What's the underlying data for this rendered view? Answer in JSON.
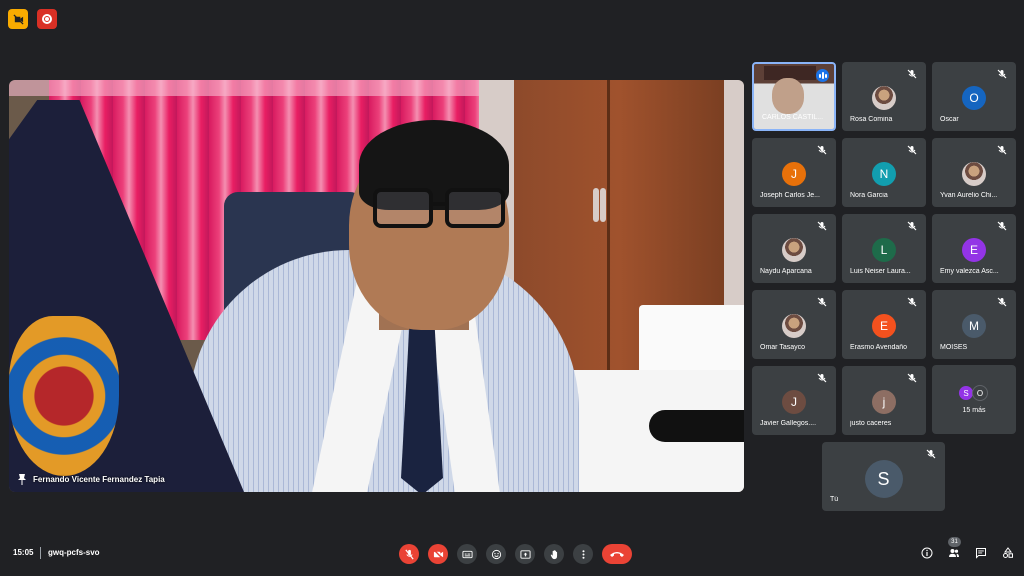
{
  "meeting": {
    "time": "15:05",
    "code": "gwq-pcfs-svo",
    "participant_count": "31"
  },
  "main_video": {
    "speaker_name": "Fernando Vicente Fernandez Tapia"
  },
  "tiles": [
    {
      "name": "CARLOS CASTIL...",
      "avatar": "",
      "color": "",
      "type": "active"
    },
    {
      "name": "Rosa Comina",
      "avatar": "",
      "color": "",
      "type": "photo"
    },
    {
      "name": "Oscar",
      "avatar": "O",
      "color": "#1565c0",
      "type": "letter"
    },
    {
      "name": "Joseph Carlos Je...",
      "avatar": "J",
      "color": "#e8710a",
      "type": "letter"
    },
    {
      "name": "Nora Garcia",
      "avatar": "N",
      "color": "#129eaf",
      "type": "letter"
    },
    {
      "name": "Yvan Aurelio Chi...",
      "avatar": "",
      "color": "",
      "type": "photo"
    },
    {
      "name": "Naydu Aparcana",
      "avatar": "",
      "color": "",
      "type": "photo"
    },
    {
      "name": "Luis Neiser Laura...",
      "avatar": "L",
      "color": "#1e6b4a",
      "type": "letter"
    },
    {
      "name": "Emy valezca Asc...",
      "avatar": "E",
      "color": "#9334e6",
      "type": "letter"
    },
    {
      "name": "Omar Tasayco",
      "avatar": "",
      "color": "",
      "type": "photo"
    },
    {
      "name": "Erasmo Avendaño",
      "avatar": "E",
      "color": "#f4511e",
      "type": "letter"
    },
    {
      "name": "MOISES",
      "avatar": "M",
      "color": "#4a5a6a",
      "type": "letter"
    },
    {
      "name": "Javier Gallegos....",
      "avatar": "J",
      "color": "#6d4c41",
      "type": "letter"
    },
    {
      "name": "justo caceres",
      "avatar": "j",
      "color": "#8d6e63",
      "type": "letter"
    }
  ],
  "more": {
    "label": "15 más",
    "a1": "S",
    "a2": "O"
  },
  "self": {
    "name": "Tú",
    "avatar": "S"
  },
  "colors": {
    "mute_red": "#ea4335",
    "speaking_blue": "#1a73e8"
  }
}
